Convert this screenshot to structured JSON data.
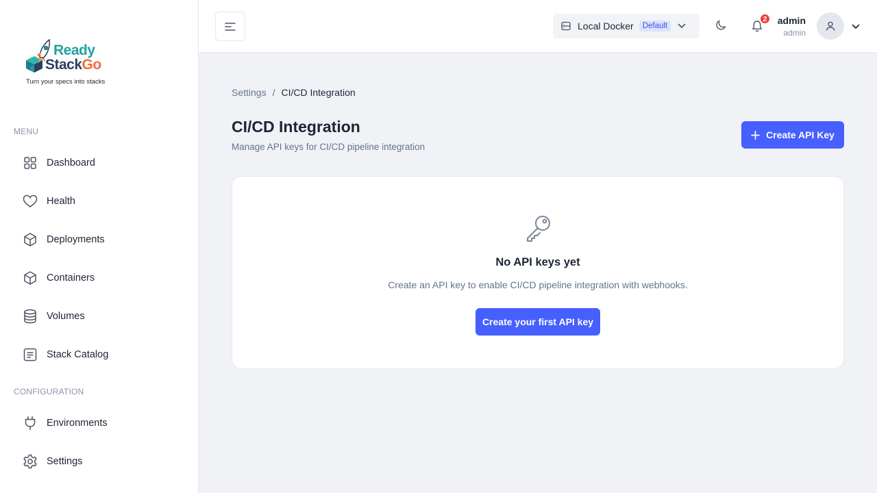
{
  "brand": {
    "name_part1": "Ready",
    "name_part2": "Stack",
    "name_part3": "Go",
    "tagline": "Turn your specs into stacks",
    "colors": {
      "teal": "#20a4a0",
      "navy": "#2c3e63",
      "orange": "#f26b3a"
    }
  },
  "sidebar": {
    "menu_heading": "MENU",
    "menu_items": [
      {
        "label": "Dashboard",
        "icon": "grid-icon"
      },
      {
        "label": "Health",
        "icon": "heart-icon"
      },
      {
        "label": "Deployments",
        "icon": "cube-icon"
      },
      {
        "label": "Containers",
        "icon": "cube-icon"
      },
      {
        "label": "Volumes",
        "icon": "database-icon"
      },
      {
        "label": "Stack Catalog",
        "icon": "catalog-icon"
      }
    ],
    "config_heading": "CONFIGURATION",
    "config_items": [
      {
        "label": "Environments",
        "icon": "plug-icon"
      },
      {
        "label": "Settings",
        "icon": "gear-icon"
      }
    ]
  },
  "header": {
    "environment": {
      "name": "Local Docker",
      "badge": "Default",
      "icon": "server-icon"
    },
    "notifications": {
      "count": "2",
      "icon": "bell-icon"
    },
    "user": {
      "name": "admin",
      "role": "admin",
      "icon": "user-icon"
    }
  },
  "breadcrumb": {
    "parent": "Settings",
    "separator": "/",
    "current": "CI/CD Integration"
  },
  "page": {
    "title": "CI/CD Integration",
    "subtitle": "Manage API keys for CI/CD pipeline integration",
    "create_button": "Create API Key"
  },
  "empty_state": {
    "icon": "key-icon",
    "title": "No API keys yet",
    "description": "Create an API key to enable CI/CD pipeline integration with webhooks.",
    "button": "Create your first API key"
  },
  "colors": {
    "primary": "#465fff",
    "badge_red": "#f03e3e",
    "page_bg": "#f1f2f6"
  }
}
